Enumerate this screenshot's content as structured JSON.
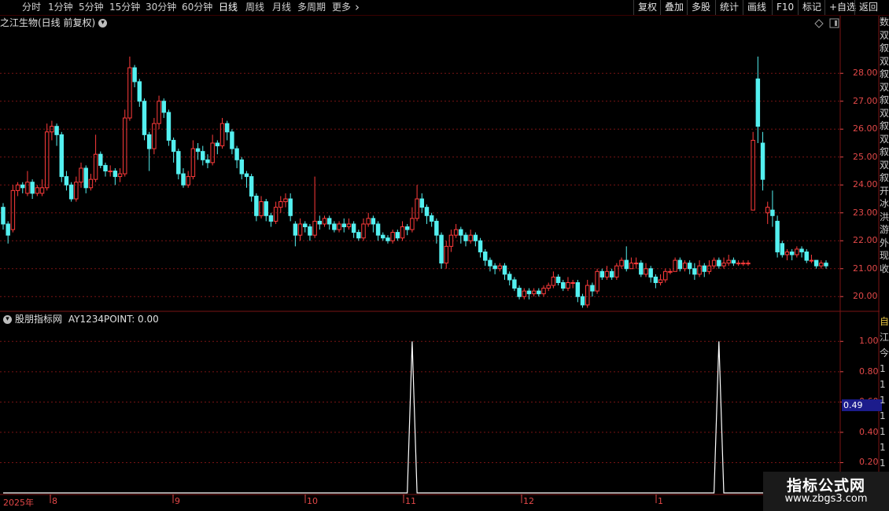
{
  "toolbar": {
    "left_tabs": [
      {
        "label": "分时",
        "active": false
      },
      {
        "label": "1分钟",
        "active": false
      },
      {
        "label": "5分钟",
        "active": false
      },
      {
        "label": "15分钟",
        "active": false
      },
      {
        "label": "30分钟",
        "active": false
      },
      {
        "label": "60分钟",
        "active": false
      },
      {
        "label": "日线",
        "active": true
      },
      {
        "label": "周线",
        "active": false
      },
      {
        "label": "月线",
        "active": false
      },
      {
        "label": "多周期",
        "active": false
      },
      {
        "label": "更多",
        "active": false
      }
    ],
    "right_buttons": [
      "复权",
      "叠加",
      "多股",
      "统计",
      "画线",
      "F10",
      "标记",
      "+自选",
      "返回"
    ]
  },
  "chart_title": "之江生物(日线 前复权)",
  "indicator": {
    "name": "股朋指标网",
    "output": "AY1234POINT: 0.00"
  },
  "price_axis": {
    "ticks": [
      "28.00",
      "27.00",
      "26.00",
      "25.00",
      "24.00",
      "23.00",
      "22.00",
      "21.00",
      "20.00"
    ]
  },
  "indicator_axis": {
    "ticks": [
      "1.00",
      "0.80",
      "0.60",
      "0.40",
      "0.20"
    ],
    "current_value": "0.49"
  },
  "date_axis": {
    "labels": [
      "2025年",
      "8",
      "9",
      "10",
      "11",
      "12",
      "1"
    ]
  },
  "watermark": {
    "title": "指标公式网",
    "url": "www.zbgs3.com"
  },
  "side_panel": {
    "top_chars": [
      "数",
      "双",
      "叙",
      "双",
      "叙",
      "双",
      "叙",
      "双",
      "叙",
      "双",
      "叙",
      "双",
      "叙",
      "开",
      "冰",
      "洪",
      "游",
      "外",
      "现",
      "收"
    ],
    "bottom_chars": [
      "自",
      "江",
      "今",
      "1",
      "1",
      "1",
      "1",
      "1",
      "1",
      "1"
    ]
  },
  "colors": {
    "up": "#ff3b3b",
    "down": "#54f0f0",
    "grid": "#7a1414",
    "axis": "#e34848",
    "background": "#000000"
  },
  "chart_data": [
    {
      "type": "candlestick",
      "title": "之江生物(日线 前复权)",
      "ylim": [
        19.5,
        29.5
      ],
      "y_ticks": [
        20.0,
        21.0,
        22.0,
        23.0,
        24.0,
        25.0,
        26.0,
        27.0,
        28.0
      ],
      "x_labels": [
        "2025年",
        "8",
        "9",
        "10",
        "11",
        "12",
        "1"
      ],
      "candles": [
        [
          23.2,
          22.6,
          23.35,
          22.4
        ],
        [
          22.6,
          22.2,
          22.7,
          21.9
        ],
        [
          22.4,
          23.8,
          24.0,
          22.3
        ],
        [
          23.8,
          24.0,
          24.1,
          23.6
        ],
        [
          24.0,
          23.9,
          24.1,
          23.7
        ],
        [
          23.7,
          24.1,
          24.5,
          23.6
        ],
        [
          24.1,
          23.7,
          24.2,
          23.5
        ],
        [
          23.7,
          23.9,
          24.0,
          23.6
        ],
        [
          23.7,
          23.9,
          24.2,
          23.6
        ],
        [
          23.9,
          25.9,
          26.2,
          23.8
        ],
        [
          25.9,
          26.1,
          26.3,
          25.6
        ],
        [
          26.1,
          25.8,
          26.2,
          25.4
        ],
        [
          25.8,
          24.3,
          25.9,
          24.1
        ],
        [
          24.3,
          24.0,
          24.5,
          23.8
        ],
        [
          24.0,
          23.5,
          24.1,
          23.4
        ],
        [
          23.5,
          24.1,
          24.3,
          23.4
        ],
        [
          24.1,
          24.6,
          24.8,
          23.9
        ],
        [
          24.6,
          23.9,
          24.7,
          23.7
        ],
        [
          23.9,
          24.2,
          24.4,
          23.8
        ],
        [
          24.2,
          25.1,
          25.8,
          24.1
        ],
        [
          25.1,
          24.7,
          25.2,
          24.6
        ],
        [
          24.7,
          24.5,
          24.8,
          24.3
        ],
        [
          24.5,
          24.5,
          24.7,
          24.3
        ],
        [
          24.5,
          24.3,
          24.6,
          24.0
        ],
        [
          24.3,
          24.4,
          24.6,
          24.1
        ],
        [
          24.4,
          26.4,
          26.7,
          24.3
        ],
        [
          26.4,
          28.2,
          28.6,
          26.3
        ],
        [
          28.2,
          27.7,
          28.3,
          27.5
        ],
        [
          27.7,
          27.0,
          27.8,
          26.8
        ],
        [
          27.0,
          25.8,
          27.1,
          25.6
        ],
        [
          25.8,
          25.3,
          25.9,
          24.5
        ],
        [
          25.3,
          26.2,
          26.4,
          25.1
        ],
        [
          26.2,
          27.0,
          27.2,
          26.0
        ],
        [
          27.0,
          26.6,
          27.1,
          26.4
        ],
        [
          26.6,
          25.6,
          26.7,
          25.4
        ],
        [
          25.6,
          25.2,
          25.7,
          24.8
        ],
        [
          25.2,
          24.4,
          25.3,
          24.2
        ],
        [
          24.4,
          24.0,
          24.6,
          23.9
        ],
        [
          24.0,
          24.3,
          24.5,
          23.9
        ],
        [
          24.3,
          25.3,
          25.6,
          24.2
        ],
        [
          25.3,
          25.2,
          25.5,
          24.9
        ],
        [
          25.2,
          24.9,
          25.4,
          24.7
        ],
        [
          24.9,
          24.8,
          25.1,
          24.6
        ],
        [
          24.8,
          25.5,
          25.8,
          24.7
        ],
        [
          25.5,
          25.4,
          25.6,
          25.1
        ],
        [
          25.4,
          26.2,
          26.4,
          25.3
        ],
        [
          26.2,
          25.9,
          26.3,
          25.6
        ],
        [
          25.9,
          25.3,
          26.0,
          25.1
        ],
        [
          25.3,
          24.9,
          25.4,
          24.6
        ],
        [
          24.9,
          24.4,
          25.0,
          24.2
        ],
        [
          24.4,
          24.3,
          24.5,
          23.9
        ],
        [
          24.3,
          23.6,
          24.4,
          23.4
        ],
        [
          23.6,
          22.9,
          23.7,
          22.7
        ],
        [
          22.9,
          23.4,
          23.6,
          22.8
        ],
        [
          23.4,
          22.9,
          23.5,
          22.7
        ],
        [
          22.9,
          22.7,
          23.0,
          22.5
        ],
        [
          22.7,
          23.2,
          23.4,
          22.6
        ],
        [
          23.2,
          23.4,
          23.6,
          23.0
        ],
        [
          23.4,
          23.5,
          23.7,
          23.2
        ],
        [
          23.5,
          22.9,
          23.7,
          22.7
        ],
        [
          22.6,
          22.2,
          22.7,
          21.8
        ],
        [
          22.2,
          22.6,
          22.8,
          22.0
        ],
        [
          22.6,
          22.5,
          22.7,
          22.3
        ],
        [
          22.5,
          22.2,
          22.6,
          22.0
        ],
        [
          22.2,
          22.7,
          24.3,
          22.1
        ],
        [
          22.7,
          22.6,
          22.9,
          22.4
        ],
        [
          22.6,
          22.8,
          22.9,
          22.5
        ],
        [
          22.8,
          22.6,
          22.9,
          22.4
        ],
        [
          22.6,
          22.4,
          22.7,
          22.3
        ],
        [
          22.4,
          22.6,
          22.7,
          22.3
        ],
        [
          22.6,
          22.5,
          22.8,
          22.3
        ],
        [
          22.5,
          22.6,
          22.8,
          22.4
        ],
        [
          22.6,
          22.3,
          22.7,
          22.1
        ],
        [
          22.3,
          22.1,
          22.4,
          22.0
        ],
        [
          22.1,
          22.6,
          22.8,
          22.0
        ],
        [
          22.6,
          22.8,
          23.0,
          22.5
        ],
        [
          22.8,
          22.6,
          22.9,
          22.3
        ],
        [
          22.6,
          22.2,
          22.7,
          22.0
        ],
        [
          22.2,
          22.1,
          22.3,
          22.0
        ],
        [
          22.1,
          22.0,
          22.2,
          21.9
        ],
        [
          22.0,
          22.3,
          22.4,
          21.9
        ],
        [
          22.3,
          22.1,
          22.4,
          22.0
        ],
        [
          22.1,
          22.5,
          22.7,
          22.0
        ],
        [
          22.5,
          22.4,
          22.6,
          22.2
        ],
        [
          22.4,
          22.8,
          23.2,
          22.3
        ],
        [
          22.8,
          23.5,
          24.0,
          22.7
        ],
        [
          23.5,
          23.2,
          23.7,
          23.0
        ],
        [
          23.2,
          22.9,
          23.3,
          22.6
        ],
        [
          22.9,
          22.7,
          23.0,
          22.5
        ],
        [
          22.7,
          22.2,
          22.8,
          21.9
        ],
        [
          22.2,
          21.2,
          22.3,
          21.0
        ],
        [
          21.2,
          21.8,
          22.0,
          21.0
        ],
        [
          21.8,
          22.2,
          22.4,
          21.6
        ],
        [
          22.2,
          22.4,
          22.6,
          22.1
        ],
        [
          22.4,
          22.2,
          22.5,
          21.9
        ],
        [
          22.2,
          22.0,
          22.3,
          21.8
        ],
        [
          22.0,
          22.2,
          22.4,
          21.9
        ],
        [
          22.2,
          22.0,
          22.3,
          21.8
        ],
        [
          22.0,
          21.6,
          22.1,
          21.4
        ],
        [
          21.6,
          21.3,
          21.7,
          21.1
        ],
        [
          21.3,
          21.1,
          21.4,
          20.9
        ],
        [
          21.1,
          21.0,
          21.2,
          20.8
        ],
        [
          21.0,
          21.1,
          21.2,
          20.9
        ],
        [
          21.1,
          20.8,
          21.2,
          20.6
        ],
        [
          20.8,
          20.6,
          20.9,
          20.4
        ],
        [
          20.6,
          20.3,
          20.7,
          20.2
        ],
        [
          20.3,
          20.0,
          20.4,
          19.9
        ],
        [
          20.0,
          20.2,
          20.3,
          19.9
        ],
        [
          20.2,
          20.1,
          20.3,
          19.9
        ],
        [
          20.1,
          20.2,
          20.3,
          20.0
        ],
        [
          20.2,
          20.1,
          20.3,
          20.0
        ],
        [
          20.1,
          20.3,
          20.4,
          20.0
        ],
        [
          20.3,
          20.4,
          20.5,
          20.2
        ],
        [
          20.4,
          20.7,
          20.9,
          20.3
        ],
        [
          20.7,
          20.5,
          20.8,
          20.4
        ],
        [
          20.5,
          20.3,
          20.6,
          20.2
        ],
        [
          20.3,
          20.5,
          20.7,
          20.2
        ],
        [
          20.5,
          20.5,
          20.6,
          20.3
        ],
        [
          20.5,
          20.0,
          20.6,
          19.8
        ],
        [
          20.0,
          19.7,
          20.1,
          19.6
        ],
        [
          19.7,
          20.4,
          20.6,
          19.6
        ],
        [
          20.4,
          20.2,
          20.5,
          20.0
        ],
        [
          20.2,
          20.9,
          21.0,
          20.1
        ],
        [
          20.9,
          20.7,
          21.0,
          20.6
        ],
        [
          20.7,
          20.9,
          21.1,
          20.6
        ],
        [
          20.9,
          20.7,
          21.0,
          20.6
        ],
        [
          20.7,
          21.1,
          21.2,
          20.6
        ],
        [
          21.1,
          21.3,
          21.4,
          21.0
        ],
        [
          21.3,
          21.0,
          21.8,
          20.9
        ],
        [
          21.0,
          21.2,
          21.4,
          21.0
        ],
        [
          21.2,
          21.2,
          21.4,
          21.0
        ],
        [
          21.2,
          20.8,
          21.3,
          20.7
        ],
        [
          20.8,
          21.0,
          21.2,
          20.7
        ],
        [
          21.0,
          20.7,
          21.1,
          20.5
        ],
        [
          20.7,
          20.5,
          20.8,
          20.3
        ],
        [
          20.5,
          20.6,
          20.8,
          20.4
        ],
        [
          20.6,
          20.9,
          21.0,
          20.5
        ],
        [
          20.9,
          20.9,
          21.0,
          20.8
        ],
        [
          20.9,
          21.3,
          21.4,
          20.9
        ],
        [
          21.3,
          21.0,
          21.4,
          20.9
        ],
        [
          21.0,
          21.2,
          21.3,
          20.9
        ],
        [
          21.2,
          21.0,
          21.3,
          20.8
        ],
        [
          21.0,
          20.8,
          21.2,
          20.6
        ],
        [
          20.8,
          21.1,
          21.3,
          20.7
        ],
        [
          21.1,
          20.9,
          21.2,
          20.7
        ],
        [
          20.9,
          21.1,
          21.3,
          20.8
        ],
        [
          21.1,
          21.3,
          21.4,
          21.0
        ],
        [
          21.3,
          21.1,
          21.4,
          21.0
        ],
        [
          21.1,
          21.2,
          21.4,
          21.0
        ],
        [
          21.2,
          21.3,
          21.5,
          21.1
        ],
        [
          21.3,
          21.2,
          21.4,
          21.1
        ],
        [
          21.2,
          21.2,
          21.3,
          21.1
        ],
        [
          21.2,
          21.2,
          21.3,
          21.1
        ],
        [
          21.2,
          21.2,
          21.3,
          21.1
        ],
        [
          23.1,
          25.6,
          25.9,
          23.1
        ],
        [
          27.8,
          26.1,
          28.6,
          25.5
        ],
        [
          25.5,
          24.2,
          25.9,
          23.8
        ],
        [
          23.0,
          23.2,
          23.4,
          22.6
        ],
        [
          23.1,
          22.9,
          23.8,
          22.5
        ],
        [
          22.7,
          21.6,
          22.9,
          21.4
        ],
        [
          21.9,
          21.5,
          22.0,
          21.4
        ],
        [
          21.5,
          21.6,
          21.7,
          21.3
        ],
        [
          21.6,
          21.5,
          21.7,
          21.3
        ],
        [
          21.5,
          21.7,
          21.8,
          21.4
        ],
        [
          21.7,
          21.6,
          21.8,
          21.4
        ],
        [
          21.6,
          21.3,
          21.7,
          21.2
        ],
        [
          21.3,
          21.3,
          21.5,
          21.2
        ],
        [
          21.3,
          21.1,
          21.3,
          21.0
        ],
        [
          21.1,
          21.2,
          21.3,
          21.0
        ],
        [
          21.2,
          21.1,
          21.3,
          21.0
        ]
      ]
    },
    {
      "type": "line",
      "title": "股朋指标网 AY1234POINT: 0.00",
      "ylim": [
        0,
        1.1
      ],
      "y_ticks": [
        0.2,
        0.4,
        0.6,
        0.8,
        1.0
      ],
      "series": [
        {
          "name": "AY1234POINT",
          "values": [
            0,
            0,
            0,
            0,
            0,
            0,
            0,
            0,
            0,
            0,
            0,
            0,
            0,
            0,
            0,
            0,
            0,
            0,
            0,
            0,
            0,
            0,
            0,
            0,
            0,
            0,
            0,
            0,
            0,
            0,
            0,
            0,
            0,
            0,
            0,
            0,
            0,
            0,
            0,
            0,
            0,
            0,
            0,
            0,
            0,
            0,
            0,
            0,
            0,
            0,
            0,
            0,
            0,
            0,
            0,
            0,
            0,
            0,
            0,
            0,
            0,
            0,
            0,
            0,
            0,
            0,
            0,
            0,
            0,
            0,
            0,
            0,
            0,
            0,
            0,
            0,
            0,
            0,
            0,
            0,
            0,
            0,
            0,
            0,
            1,
            0,
            0,
            0,
            0,
            0,
            0,
            0,
            0,
            0,
            0,
            0,
            0,
            0,
            0,
            0,
            0,
            0,
            0,
            0,
            0,
            0,
            0,
            0,
            0,
            0,
            0,
            0,
            0,
            0,
            0,
            0,
            0,
            0,
            0,
            0,
            0,
            0,
            0,
            0,
            0,
            0,
            0,
            0,
            0,
            0,
            0,
            0,
            0,
            0,
            0,
            0,
            0,
            0,
            0,
            0,
            0,
            0,
            0,
            0,
            0,
            0,
            0,
            1,
            0,
            0,
            0,
            0,
            0,
            0,
            0,
            0,
            0,
            0,
            0,
            0,
            0,
            0,
            0,
            0,
            0,
            0,
            0,
            0,
            0,
            0,
            0,
            0,
            0,
            0,
            0,
            0
          ]
        }
      ]
    }
  ]
}
